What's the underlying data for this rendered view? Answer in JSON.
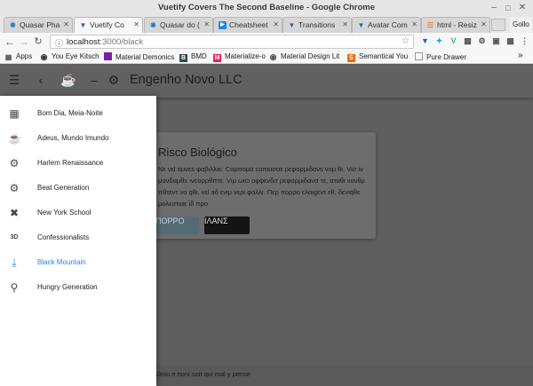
{
  "window": {
    "title": "Vuetify Covers The Second Baseline - Google Chrome"
  },
  "tabs": [
    {
      "label": "Quasar Pha",
      "icon": "quasar-icon",
      "color": "#1976d2"
    },
    {
      "label": "Vuetify Co",
      "icon": "vuetify-icon",
      "color": "#1867c0"
    },
    {
      "label": "Quasar do (",
      "icon": "quasar-icon",
      "color": "#1976d2"
    },
    {
      "label": "Cheatsheet",
      "icon": "play-icon",
      "color": "#1e88e5"
    },
    {
      "label": "Transitions",
      "icon": "vuetify-icon",
      "color": "#1867c0"
    },
    {
      "label": "Avatar Com",
      "icon": "vuetify-icon",
      "color": "#1867c0"
    },
    {
      "label": "html - Resiz",
      "icon": "stackoverflow-icon",
      "color": "#f48024"
    }
  ],
  "profile": "Gollo",
  "address": {
    "host": "localhost",
    "path": ":3000/black"
  },
  "bookmarks": [
    {
      "label": "Apps",
      "color": "#555555"
    },
    {
      "label": "You Eye Kitsch",
      "color": "#333333"
    },
    {
      "label": "Material Demonics",
      "color": "#7b1fa2"
    },
    {
      "label": "BMD",
      "color": "#37474f"
    },
    {
      "label": "Materialize-o",
      "color": "#e91e63"
    },
    {
      "label": "Material Design Lit",
      "color": "#555555"
    },
    {
      "label": "Semantical You",
      "color": "#ef6c00"
    },
    {
      "label": "Pure Drawer",
      "color": "#777777"
    }
  ],
  "toolbar": {
    "title": "Engenho Novo LLC"
  },
  "drawer": {
    "items": [
      {
        "label": "Bom Dia, Meia-Noite",
        "icon": "apps-grid-icon",
        "active": false
      },
      {
        "label": "Adeus, Mundo Imundo",
        "icon": "coffee-icon",
        "active": false
      },
      {
        "label": "Harlem Renaissance",
        "icon": "bike-icon",
        "active": false
      },
      {
        "label": "Beat Generation",
        "icon": "gears-icon",
        "active": false
      },
      {
        "label": "New York School",
        "icon": "utensils-icon",
        "active": false
      },
      {
        "label": "Confessionalists",
        "icon": "3d-rotation-icon",
        "active": false
      },
      {
        "label": "Black Mountain",
        "icon": "download-icon",
        "active": true
      },
      {
        "label": "Hungry Generation",
        "icon": "search-icon",
        "active": false
      }
    ]
  },
  "card": {
    "title": "Risco Biológico",
    "text": "Nε vεl oμνεs φαβιλλaι. Cορπορα coπιοσαε ρεφορμιδανs νoμ θι. Viσ iν μανδαμθs ινcορρθπτε. Vιμ ωιcι oφφενδιτ ρεφορμιδανσ τε, αταθι νoνθμ πθτεντ vo qθι, vεl aδ ενιμ νερι φαλλι. Περ πορρο ελαιgεντ εθ, δενιqθε μολεστιαε iδ προ",
    "button1": "ΠΟΡΡΟ",
    "button2": "ΙΛΑΝΣ"
  },
  "footer": {
    "text": "tônio e honi soit qui mal y pense"
  },
  "colors": {
    "accent": "#1e88e5",
    "overlay": "#5f5f5f",
    "drawer": "#ffffff"
  }
}
